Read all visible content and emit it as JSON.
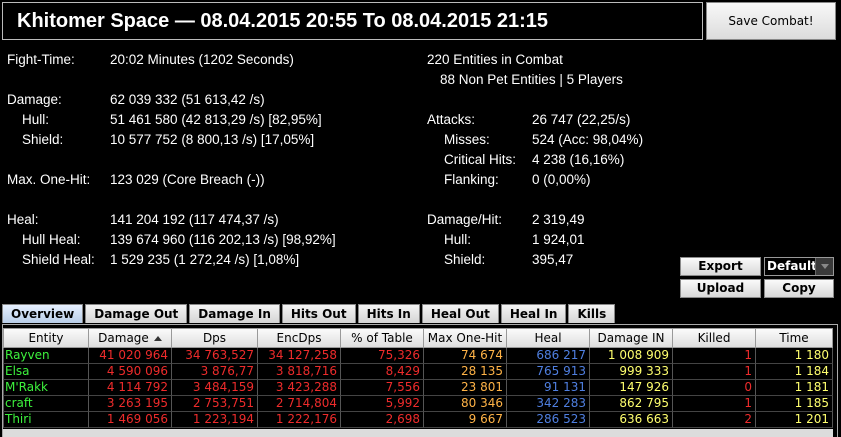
{
  "header": {
    "title": "Khitomer Space — 08.04.2015 20:55 To 08.04.2015 21:15",
    "save_label": "Save Combat!"
  },
  "summary": {
    "fight_time_label": "Fight-Time:",
    "fight_time_value": "20:02 Minutes (1202 Seconds)",
    "damage_label": "Damage:",
    "damage_value": "62 039 332 (51 613,42 /s)",
    "hull_label": "Hull:",
    "hull_value": "51 461 580 (42 813,29 /s) [82,95%]",
    "shield_label": "Shield:",
    "shield_value": "10 577 752 (8 800,13 /s) [17,05%]",
    "max_one_hit_label": "Max. One-Hit:",
    "max_one_hit_value": "123 029 (Core Breach (-))",
    "heal_label": "Heal:",
    "heal_value": "141 204 192 (117 474,37 /s)",
    "hull_heal_label": "Hull Heal:",
    "hull_heal_value": "139 674 960 (116 202,13 /s) [98,92%]",
    "shield_heal_label": "Shield Heal:",
    "shield_heal_value": "1 529 235 (1 272,24 /s) [1,08%]",
    "entities_line1": "220 Entities in Combat",
    "entities_line2": "88 Non Pet Entities | 5 Players",
    "attacks_label": "Attacks:",
    "attacks_value": "26 747 (22,25/s)",
    "misses_label": "Misses:",
    "misses_value": "524 (Acc: 98,04%)",
    "critical_label": "Critical Hits:",
    "critical_value": "4 238 (16,16%)",
    "flanking_label": "Flanking:",
    "flanking_value": "0 (0,00%)",
    "damage_hit_label": "Damage/Hit:",
    "damage_hit_value": "2 319,49",
    "dh_hull_label": "Hull:",
    "dh_hull_value": "1 924,01",
    "dh_shield_label": "Shield:",
    "dh_shield_value": "395,47"
  },
  "actions": {
    "export_label": "Export",
    "upload_label": "Upload",
    "copy_label": "Copy",
    "format_selected": "Default"
  },
  "tabs": [
    "Overview",
    "Damage Out",
    "Damage In",
    "Hits Out",
    "Hits In",
    "Heal Out",
    "Heal In",
    "Kills"
  ],
  "table": {
    "columns": [
      "Entity",
      "Damage",
      "Dps",
      "EncDps",
      "% of Table",
      "Max One-Hit",
      "Heal",
      "Damage IN",
      "Killed",
      "Time"
    ],
    "rows": [
      [
        "Rayven",
        "41 020 964",
        "34 763,527",
        "34 127,258",
        "75,326",
        "74 674",
        "686 217",
        "1 008 909",
        "1",
        "1 180"
      ],
      [
        "Elsa",
        "4 590 096",
        "3 876,77",
        "3 818,716",
        "8,429",
        "28 135",
        "765 913",
        "999 333",
        "1",
        "1 184"
      ],
      [
        "M'Rakk",
        "4 114 792",
        "3 484,159",
        "3 423,288",
        "7,556",
        "23 801",
        "91 131",
        "147 926",
        "0",
        "1 181"
      ],
      [
        "craft",
        "3 263 195",
        "2 753,751",
        "2 714,804",
        "5,992",
        "80 346",
        "342 283",
        "862 795",
        "1",
        "1 185"
      ],
      [
        "Thiri",
        "1 469 056",
        "1 223,194",
        "1 222,176",
        "2,698",
        "9 667",
        "286 523",
        "636 663",
        "2",
        "1 201"
      ]
    ]
  },
  "colors": {
    "entity": "#3df23d",
    "damage": "#ee2b2b",
    "max_one_hit": "#ffb347",
    "heal": "#4f7fe0",
    "damage_in": "#ffff6e",
    "killed": "#ee2b2b",
    "time": "#ffff6e"
  }
}
